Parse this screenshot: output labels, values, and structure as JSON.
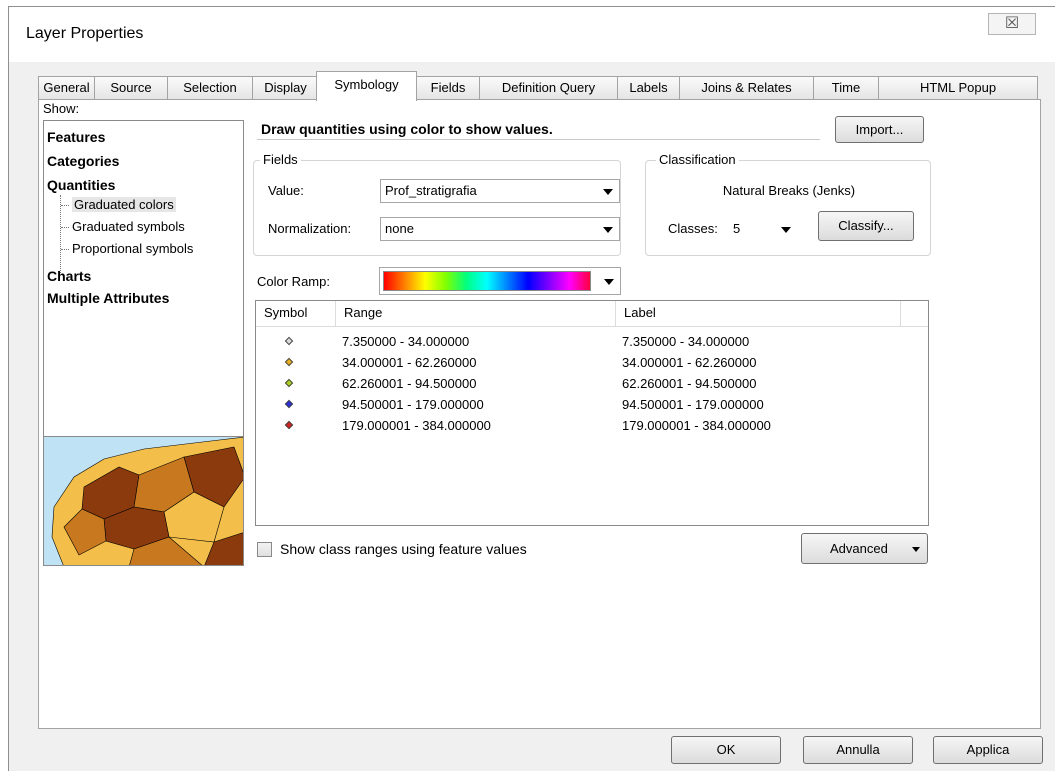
{
  "window": {
    "title": "Layer Properties",
    "close_glyph": "☒"
  },
  "tabs": [
    "General",
    "Source",
    "Selection",
    "Display",
    "Symbology",
    "Fields",
    "Definition Query",
    "Labels",
    "Joins & Relates",
    "Time",
    "HTML Popup"
  ],
  "active_tab": "Symbology",
  "show": {
    "label": "Show:",
    "items": {
      "features": "Features",
      "categories": "Categories",
      "quantities": "Quantities",
      "graduated_colors": "Graduated colors",
      "graduated_symbols": "Graduated symbols",
      "proportional_symbols": "Proportional symbols",
      "charts": "Charts",
      "multiple_attributes": "Multiple Attributes"
    },
    "selected": "Graduated colors"
  },
  "description": "Draw quantities using color to show values.",
  "import_label": "Import...",
  "fields": {
    "title": "Fields",
    "value_label": "Value:",
    "value": "Prof_stratigrafia",
    "normalization_label": "Normalization:",
    "normalization": "none"
  },
  "classification": {
    "title": "Classification",
    "method": "Natural Breaks (Jenks)",
    "classes_label": "Classes:",
    "classes": "5",
    "classify_label": "Classify..."
  },
  "color_ramp": {
    "label": "Color Ramp:",
    "colors": [
      "#ff0000",
      "#ff8000",
      "#ffff00",
      "#80ff00",
      "#00ff80",
      "#00ffff",
      "#0080ff",
      "#0000ff",
      "#8000ff",
      "#ff00ff",
      "#ff0040"
    ]
  },
  "classes_table": {
    "headers": {
      "symbol": "Symbol",
      "range": "Range",
      "label": "Label"
    },
    "rows": [
      {
        "color": "#d9d9d9",
        "range": "7.350000 - 34.000000",
        "label": "7.350000 - 34.000000"
      },
      {
        "color": "#e8b020",
        "range": "34.000001 - 62.260000",
        "label": "34.000001 - 62.260000"
      },
      {
        "color": "#a8d020",
        "range": "62.260001 - 94.500000",
        "label": "62.260001 - 94.500000"
      },
      {
        "color": "#2a30d8",
        "range": "94.500001 - 179.000000",
        "label": "94.500001 - 179.000000"
      },
      {
        "color": "#d02020",
        "range": "179.000001 - 384.000000",
        "label": "179.000001 - 384.000000"
      }
    ]
  },
  "show_ranges_label": "Show class ranges using feature values",
  "advanced_label": "Advanced",
  "buttons": {
    "ok": "OK",
    "cancel": "Annulla",
    "apply": "Applica"
  },
  "preview_colors": {
    "dark": "#8b3a0e",
    "medium": "#c8781e",
    "light": "#f3bf4a",
    "water": "#bfe2f5"
  }
}
